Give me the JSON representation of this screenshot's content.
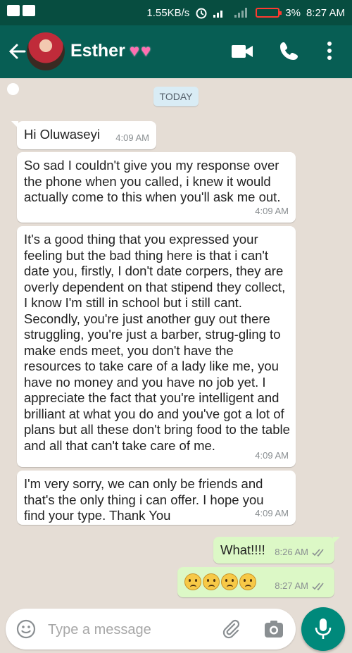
{
  "status_bar": {
    "speed": "1.55KB/s",
    "battery": "3%",
    "time": "8:27 AM"
  },
  "header": {
    "contact_name": "Esther",
    "hearts": "💖💖"
  },
  "date_chip": "TODAY",
  "messages": [
    {
      "direction": "in",
      "text": "Hi Oluwaseyi",
      "time": "4:09 AM"
    },
    {
      "direction": "in",
      "text": "So sad I couldn't give you my response over the phone when you called, i knew it would actually come to this when you'll ask me out.",
      "time": "4:09 AM"
    },
    {
      "direction": "in",
      "text": "It's a good thing that you expressed your feeling but the bad thing here is that i can't date you, firstly, I don't date corpers, they are overly dependent on that stipend they collect, I know I'm still in school but i still cant. Secondly, you're just another guy out there struggling, you're just a barber, strug-gling to make ends meet, you don't have the resources to take care of a lady like me, you have no money and you have no job yet. I appreciate the fact that you're intelligent and brilliant at what you do and you've got a lot of plans but all these don't bring food to the table and all that can't take care of me.",
      "time": "4:09 AM"
    },
    {
      "direction": "in",
      "text": "I'm very sorry, we can only be friends and that's the only thing i can offer. I hope you find your type. Thank You",
      "time": "4:09 AM"
    },
    {
      "direction": "out",
      "text": "What!!!!",
      "time": "8:26 AM"
    },
    {
      "direction": "out",
      "text": "",
      "emoji_count": 4,
      "time": "8:27 AM"
    }
  ],
  "input": {
    "placeholder": "Type a message"
  },
  "colors": {
    "header": "#075e54",
    "status_bar": "#074d40",
    "chat_bg": "#e5ddd5",
    "outgoing_bubble": "#dcf8c6",
    "incoming_bubble": "#ffffff",
    "fab": "#00897b"
  },
  "icons": {
    "status_left": [
      "gmail-icon",
      "gmail-icon",
      "chat-icon"
    ],
    "header_right": [
      "video-call-icon",
      "phone-icon",
      "more-options-icon"
    ],
    "input": [
      "emoji-icon",
      "attach-icon",
      "camera-icon",
      "mic-icon"
    ]
  }
}
